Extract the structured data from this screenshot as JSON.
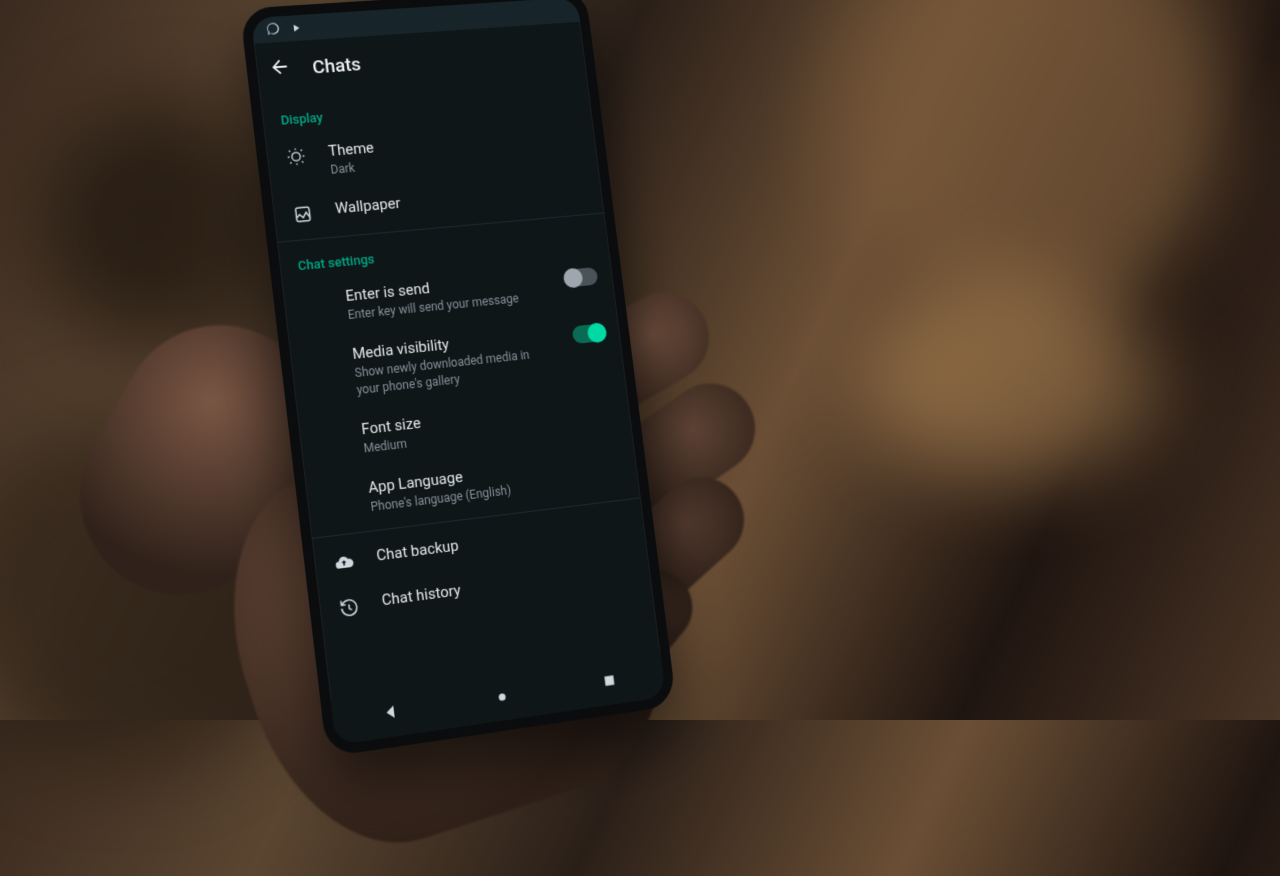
{
  "colors": {
    "accent": "#00a884",
    "bg": "#0f1618",
    "text": "#e4e9eb",
    "sub": "#849198"
  },
  "appbar": {
    "title": "Chats"
  },
  "sections": {
    "display": {
      "header": "Display",
      "theme": {
        "title": "Theme",
        "value": "Dark"
      },
      "wallpaper": {
        "title": "Wallpaper"
      }
    },
    "chat": {
      "header": "Chat settings",
      "enter_is_send": {
        "title": "Enter is send",
        "desc": "Enter key will send your message",
        "on": false
      },
      "media_visibility": {
        "title": "Media visibility",
        "desc": "Show newly downloaded media in your phone's gallery",
        "on": true
      },
      "font_size": {
        "title": "Font size",
        "value": "Medium"
      },
      "app_language": {
        "title": "App Language",
        "value": "Phone's language (English)"
      }
    },
    "backup": {
      "title": "Chat backup"
    },
    "history": {
      "title": "Chat history"
    }
  }
}
